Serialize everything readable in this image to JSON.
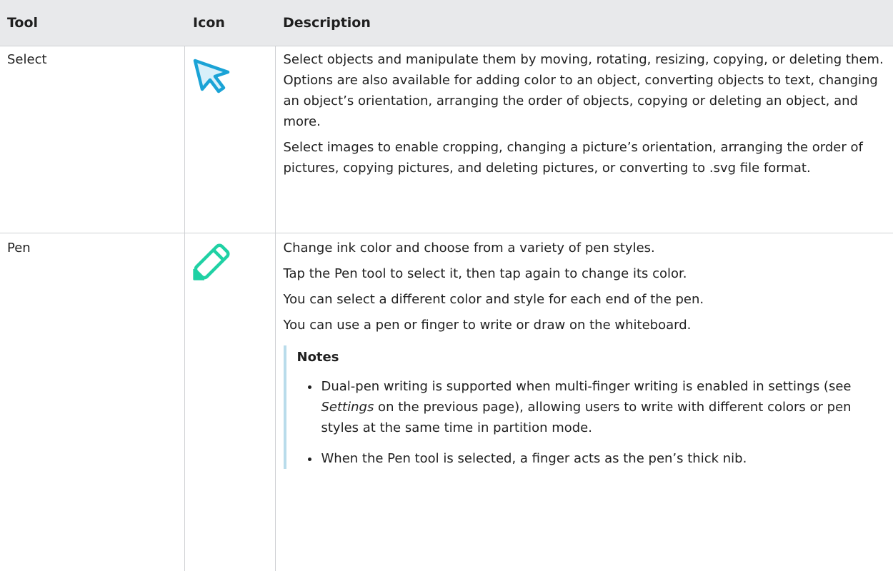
{
  "header": {
    "tool": "Tool",
    "icon": "Icon",
    "description": "Description"
  },
  "rows": [
    {
      "tool": "Select",
      "icon": "cursor-arrow-icon",
      "icon_color": "#1aa3d6",
      "paragraphs": [
        "Select objects and manipulate them by moving, rotating, resizing, copying, or deleting them. Options are also available for adding color to an object, converting objects to text, changing an object’s orientation, arranging the order of objects, copying or deleting an object, and more.",
        "Select images to enable cropping, changing a picture’s orientation, arranging the order of pictures, copying pictures, and deleting pictures, or converting to .svg file format."
      ]
    },
    {
      "tool": "Pen",
      "icon": "pen-icon",
      "icon_color": "#1fd1a4",
      "paragraphs": [
        "Change ink color and choose from a variety of pen styles.",
        "Tap the Pen tool to select it, then tap again to change its color.",
        "You can select a different color and style for each end of the pen.",
        "You can use a pen or finger to write or draw on the whiteboard."
      ],
      "notes": {
        "title": "Notes",
        "item1_before": "Dual-pen writing is supported when multi-finger writing is enabled in settings (see ",
        "item1_link": "Settings",
        "item1_after": " on the previous page), allowing users to write with different colors or pen styles at the same time in partition mode.",
        "item2": "When the Pen tool is selected, a finger acts as the pen’s thick nib."
      }
    }
  ]
}
